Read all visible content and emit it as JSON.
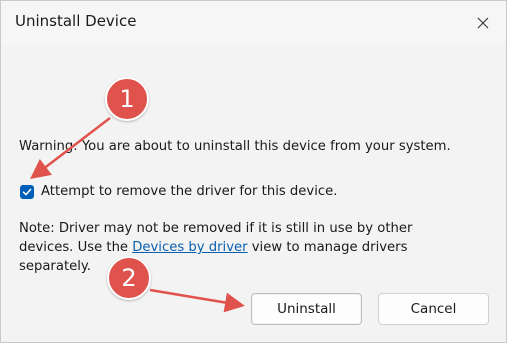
{
  "window": {
    "title": "Uninstall Device",
    "close_icon": "close-icon"
  },
  "content": {
    "warning": "Warning: You are about to uninstall this device from your system.",
    "checkbox": {
      "label": "Attempt to remove the driver for this device.",
      "checked": true
    },
    "note": {
      "line1": "Note: Driver may not be removed if it is still in use by other",
      "line2_before": "devices. Use the ",
      "link": "Devices by driver",
      "line2_after": " view to manage drivers",
      "line3": "separately."
    }
  },
  "buttons": {
    "uninstall": "Uninstall",
    "cancel": "Cancel"
  },
  "annotations": {
    "badge1": "1",
    "badge2": "2",
    "color": "#e0534d"
  },
  "colors": {
    "accent": "#005fb8",
    "link": "#0a5fb0"
  }
}
